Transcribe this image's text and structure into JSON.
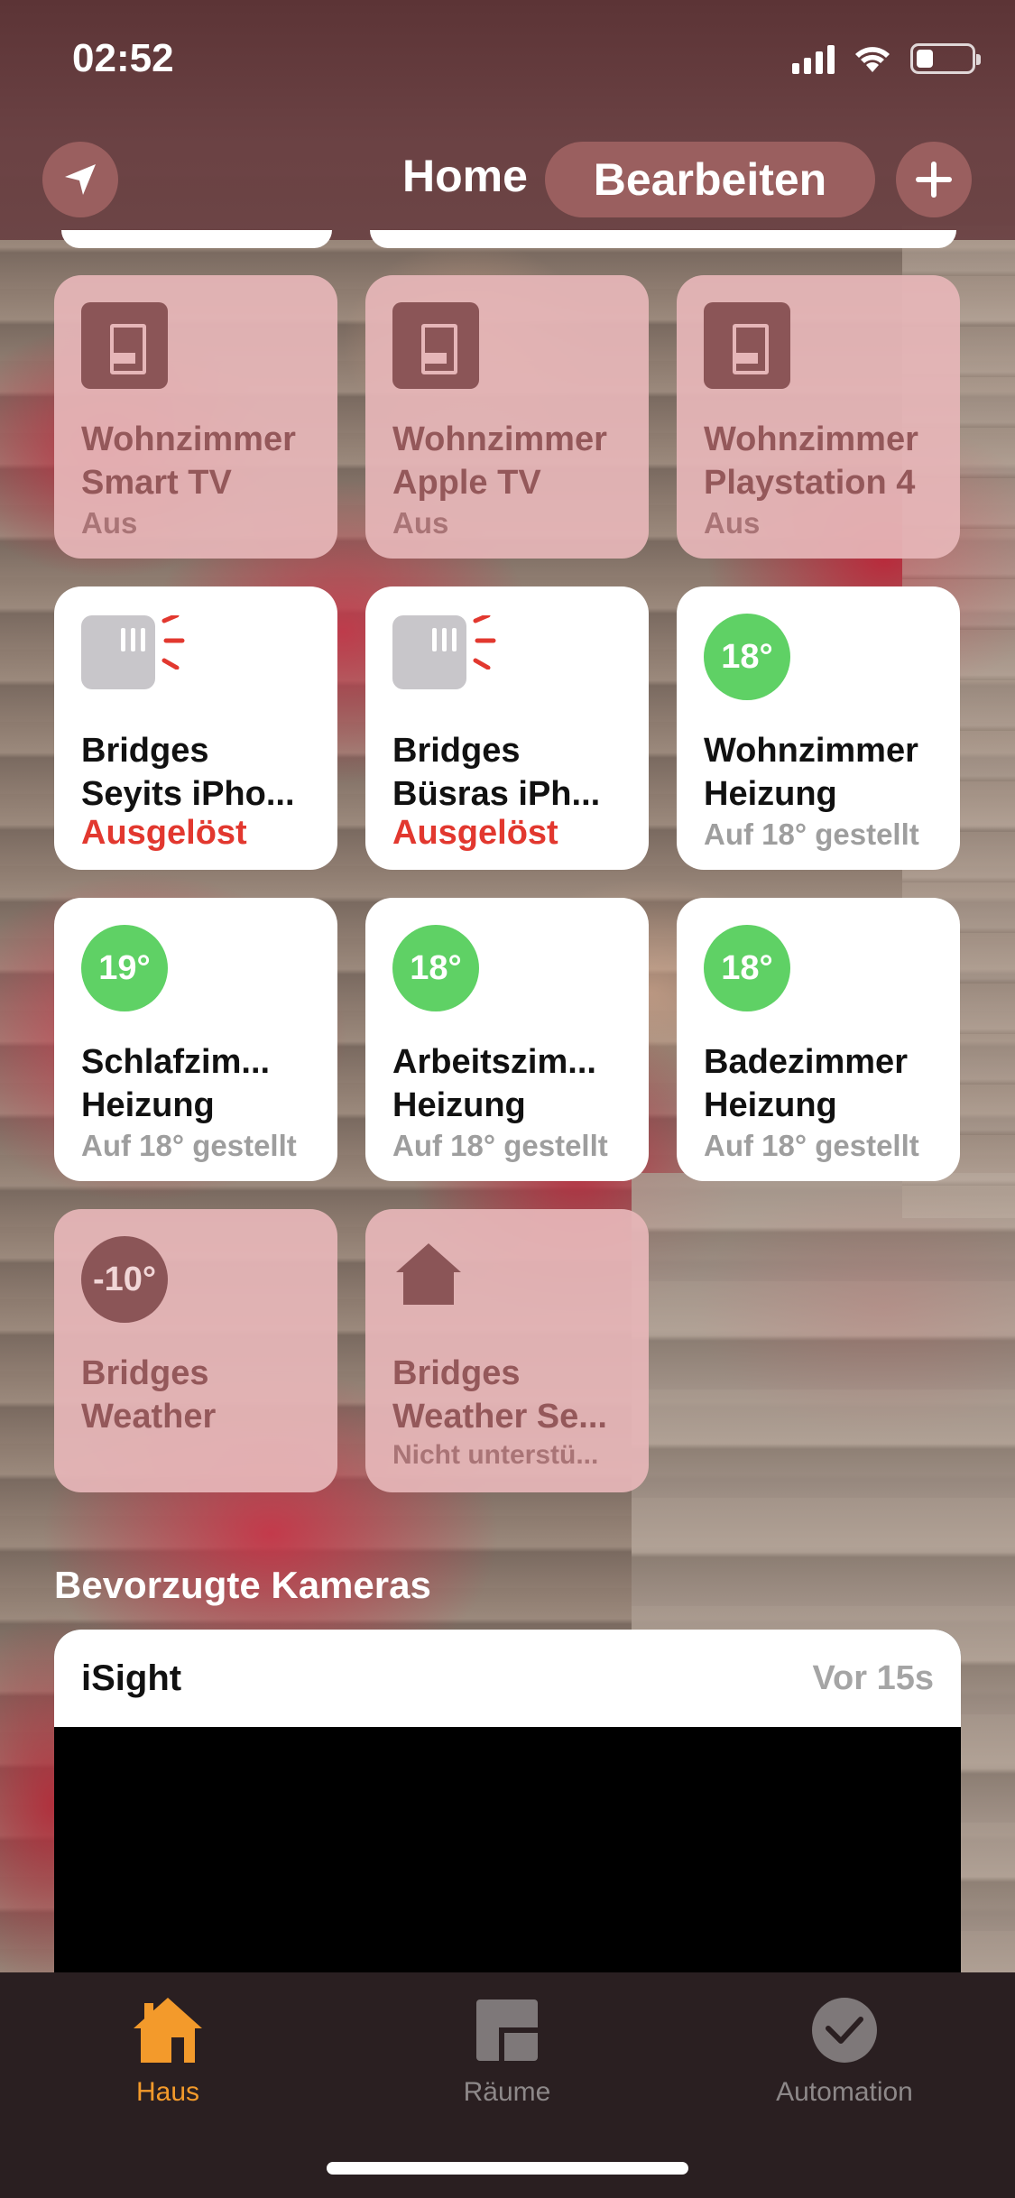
{
  "status_bar": {
    "time": "02:52"
  },
  "header": {
    "title": "Home",
    "edit_label": "Bearbeiten"
  },
  "tiles": [
    {
      "name1": "Wohnzimmer",
      "name2": "Smart TV",
      "status": "Aus"
    },
    {
      "name1": "Wohnzimmer",
      "name2": "Apple TV",
      "status": "Aus"
    },
    {
      "name1": "Wohnzimmer",
      "name2": "Playstation 4",
      "status": "Aus"
    },
    {
      "name1": "Bridges",
      "name2": "Seyits iPho...",
      "status": "Ausgelöst"
    },
    {
      "name1": "Bridges",
      "name2": "Büsras iPh...",
      "status": "Ausgelöst"
    },
    {
      "name1": "Wohnzimmer",
      "name2": "Heizung",
      "status": "Auf 18° gestellt",
      "temp": "18°"
    },
    {
      "name1": "Schlafzim...",
      "name2": "Heizung",
      "status": "Auf 18° gestellt",
      "temp": "19°"
    },
    {
      "name1": "Arbeitszim...",
      "name2": "Heizung",
      "status": "Auf 18° gestellt",
      "temp": "18°"
    },
    {
      "name1": "Badezimmer",
      "name2": "Heizung",
      "status": "Auf 18° gestellt",
      "temp": "18°"
    },
    {
      "name1": "Bridges",
      "name2": "Weather",
      "temp": "-10°"
    },
    {
      "name1": "Bridges",
      "name2": "Weather Se...",
      "status": "Nicht unterstü..."
    }
  ],
  "cameras": {
    "title": "Bevorzugte Kameras",
    "items": [
      {
        "name": "iSight",
        "time": "Vor 15s"
      }
    ]
  },
  "tabbar": {
    "items": [
      {
        "label": "Haus",
        "active": true
      },
      {
        "label": "Räume",
        "active": false
      },
      {
        "label": "Automation",
        "active": false
      }
    ]
  },
  "colors": {
    "tab_active": "#f39a2b",
    "temp_green": "#5fd165",
    "alert_red": "#e2382f",
    "tile_off": "#e6b6b8"
  }
}
